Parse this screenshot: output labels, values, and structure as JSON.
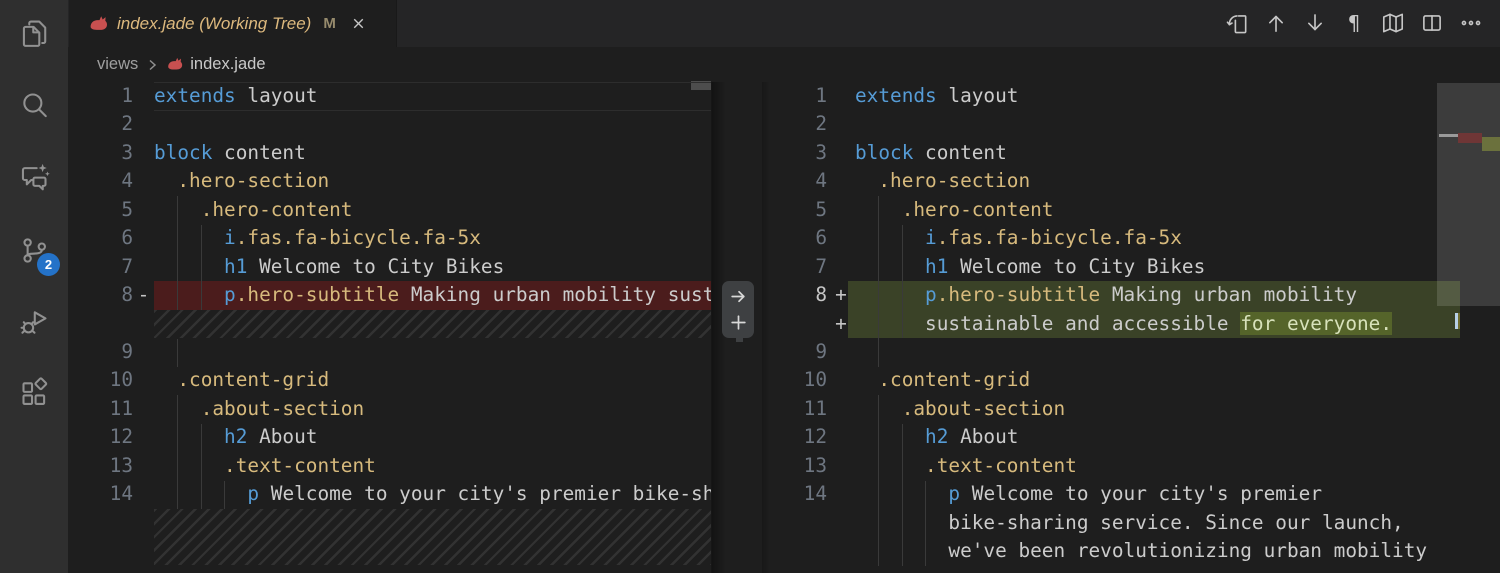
{
  "activity_bar": {
    "items": [
      {
        "name": "explorer"
      },
      {
        "name": "search"
      },
      {
        "name": "chat"
      },
      {
        "name": "source-control",
        "badge": "2"
      },
      {
        "name": "run-and-debug"
      },
      {
        "name": "extensions"
      }
    ],
    "badge": "2"
  },
  "tab": {
    "label": "index.jade (Working Tree)",
    "modified_indicator": "M",
    "icon": "pug-icon"
  },
  "editor_toolbar": {
    "icons": [
      "open-changes",
      "previous-change",
      "next-change",
      "toggle-whitespace",
      "accessible-diff-map",
      "split-editor",
      "more-actions"
    ],
    "pilcrow_glyph": "¶"
  },
  "breadcrumb": {
    "folder": "views",
    "file": "index.jade"
  },
  "diff_widget": {
    "actions": [
      "revert-block-arrow",
      "add-block-plus"
    ]
  },
  "left_editor": {
    "rows": [
      {
        "n": "1",
        "cur": true,
        "segs": [
          [
            "kw",
            "extends"
          ],
          [
            "pl",
            " layout"
          ]
        ]
      },
      {
        "n": "2",
        "segs": []
      },
      {
        "n": "3",
        "segs": [
          [
            "kw",
            "block"
          ],
          [
            "pl",
            " content"
          ]
        ]
      },
      {
        "n": "4",
        "segs": [
          [
            "pl",
            "  "
          ],
          [
            "cls",
            ".hero-section"
          ]
        ]
      },
      {
        "n": "5",
        "segs": [
          [
            "pl",
            "    "
          ],
          [
            "cls",
            ".hero-content"
          ]
        ]
      },
      {
        "n": "6",
        "segs": [
          [
            "pl",
            "      "
          ],
          [
            "kw",
            "i"
          ],
          [
            "cls",
            ".fas.fa-bicycle.fa-5x"
          ]
        ]
      },
      {
        "n": "7",
        "segs": [
          [
            "pl",
            "      "
          ],
          [
            "kw",
            "h1"
          ],
          [
            "pl",
            " Welcome to City Bikes"
          ]
        ]
      },
      {
        "n": "8",
        "sign": "-",
        "bg": "del",
        "segs": [
          [
            "pl",
            "      "
          ],
          [
            "kw",
            "p"
          ],
          [
            "cls",
            ".hero-subtitle"
          ],
          [
            "pl",
            " Making urban mobility sustainable and accessible."
          ]
        ]
      },
      {
        "hatch": 1
      },
      {
        "n": "9",
        "segs": []
      },
      {
        "n": "10",
        "segs": [
          [
            "pl",
            "  "
          ],
          [
            "cls",
            ".content-grid"
          ]
        ]
      },
      {
        "n": "11",
        "segs": [
          [
            "pl",
            "    "
          ],
          [
            "cls",
            ".about-section"
          ]
        ]
      },
      {
        "n": "12",
        "segs": [
          [
            "pl",
            "      "
          ],
          [
            "kw",
            "h2"
          ],
          [
            "pl",
            " About"
          ]
        ]
      },
      {
        "n": "13",
        "segs": [
          [
            "pl",
            "      "
          ],
          [
            "cls",
            ".text-content"
          ]
        ]
      },
      {
        "n": "14",
        "segs": [
          [
            "pl",
            "        "
          ],
          [
            "kw",
            "p"
          ],
          [
            "pl",
            " Welcome to your city's premier bike-sharing service. Since our launch, we've been revolutionizing urban mobility"
          ]
        ]
      },
      {
        "hatch": 2
      }
    ]
  },
  "right_editor": {
    "rows": [
      {
        "n": "1",
        "segs": [
          [
            "kw",
            "extends"
          ],
          [
            "pl",
            " layout"
          ]
        ]
      },
      {
        "n": "2",
        "segs": []
      },
      {
        "n": "3",
        "segs": [
          [
            "kw",
            "block"
          ],
          [
            "pl",
            " content"
          ]
        ]
      },
      {
        "n": "4",
        "segs": [
          [
            "pl",
            "  "
          ],
          [
            "cls",
            ".hero-section"
          ]
        ]
      },
      {
        "n": "5",
        "segs": [
          [
            "pl",
            "    "
          ],
          [
            "cls",
            ".hero-content"
          ]
        ]
      },
      {
        "n": "6",
        "segs": [
          [
            "pl",
            "      "
          ],
          [
            "kw",
            "i"
          ],
          [
            "cls",
            ".fas.fa-bicycle.fa-5x"
          ]
        ]
      },
      {
        "n": "7",
        "segs": [
          [
            "pl",
            "      "
          ],
          [
            "kw",
            "h1"
          ],
          [
            "pl",
            " Welcome to City Bikes"
          ]
        ]
      },
      {
        "n": "8",
        "sign": "+",
        "bg": "add",
        "nb": true,
        "segs": [
          [
            "pl",
            "      "
          ],
          [
            "kw",
            "p"
          ],
          [
            "cls",
            ".hero-subtitle"
          ],
          [
            "pl",
            " Making urban mobility"
          ]
        ]
      },
      {
        "n": "",
        "sign": "+",
        "bg": "add",
        "segs": [
          [
            "pl",
            "      "
          ],
          [
            "pl",
            "sustainable and accessible "
          ],
          [
            "hl",
            "for everyone."
          ]
        ]
      },
      {
        "n": "9",
        "segs": []
      },
      {
        "n": "10",
        "segs": [
          [
            "pl",
            "  "
          ],
          [
            "cls",
            ".content-grid"
          ]
        ]
      },
      {
        "n": "11",
        "segs": [
          [
            "pl",
            "    "
          ],
          [
            "cls",
            ".about-section"
          ]
        ]
      },
      {
        "n": "12",
        "segs": [
          [
            "pl",
            "      "
          ],
          [
            "kw",
            "h2"
          ],
          [
            "pl",
            " About"
          ]
        ]
      },
      {
        "n": "13",
        "segs": [
          [
            "pl",
            "      "
          ],
          [
            "cls",
            ".text-content"
          ]
        ]
      },
      {
        "n": "14",
        "segs": [
          [
            "pl",
            "        "
          ],
          [
            "kw",
            "p"
          ],
          [
            "pl",
            " Welcome to your city's premier"
          ]
        ]
      },
      {
        "n": "",
        "segs": [
          [
            "pl",
            "        "
          ],
          [
            "pl",
            "bike-sharing service. Since our launch,"
          ]
        ]
      },
      {
        "n": "",
        "segs": [
          [
            "pl",
            "        "
          ],
          [
            "pl",
            "we've been revolutionizing urban mobility"
          ]
        ]
      }
    ]
  },
  "colors": {
    "editor_bg": "#1e1e1e",
    "tabstrip_bg": "#252526",
    "activitybar_bg": "#2f2f2f",
    "keyword": "#569cd6",
    "class_name": "#d7ba7d",
    "text": "#cccccc",
    "line_number": "#6e7681",
    "deleted_line_bg": "#4b1c1c",
    "added_line_bg": "#3a4227",
    "added_char_bg": "#55642a",
    "badge_bg": "#2472c8",
    "tab_label": "#ddb97e",
    "pug_red": "#c85050"
  }
}
